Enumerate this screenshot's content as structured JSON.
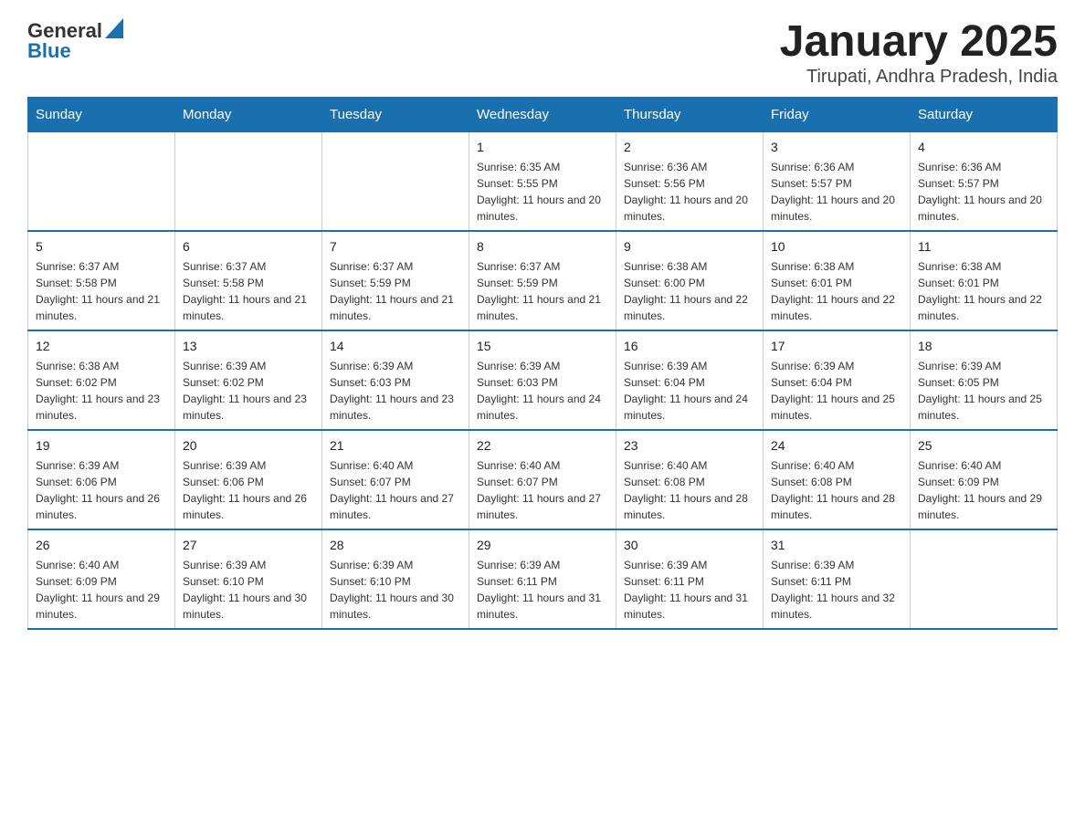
{
  "logo": {
    "text_general": "General",
    "text_blue": "Blue"
  },
  "header": {
    "title": "January 2025",
    "subtitle": "Tirupati, Andhra Pradesh, India"
  },
  "days_of_week": [
    "Sunday",
    "Monday",
    "Tuesday",
    "Wednesday",
    "Thursday",
    "Friday",
    "Saturday"
  ],
  "weeks": [
    [
      {
        "day": "",
        "info": ""
      },
      {
        "day": "",
        "info": ""
      },
      {
        "day": "",
        "info": ""
      },
      {
        "day": "1",
        "info": "Sunrise: 6:35 AM\nSunset: 5:55 PM\nDaylight: 11 hours and 20 minutes."
      },
      {
        "day": "2",
        "info": "Sunrise: 6:36 AM\nSunset: 5:56 PM\nDaylight: 11 hours and 20 minutes."
      },
      {
        "day": "3",
        "info": "Sunrise: 6:36 AM\nSunset: 5:57 PM\nDaylight: 11 hours and 20 minutes."
      },
      {
        "day": "4",
        "info": "Sunrise: 6:36 AM\nSunset: 5:57 PM\nDaylight: 11 hours and 20 minutes."
      }
    ],
    [
      {
        "day": "5",
        "info": "Sunrise: 6:37 AM\nSunset: 5:58 PM\nDaylight: 11 hours and 21 minutes."
      },
      {
        "day": "6",
        "info": "Sunrise: 6:37 AM\nSunset: 5:58 PM\nDaylight: 11 hours and 21 minutes."
      },
      {
        "day": "7",
        "info": "Sunrise: 6:37 AM\nSunset: 5:59 PM\nDaylight: 11 hours and 21 minutes."
      },
      {
        "day": "8",
        "info": "Sunrise: 6:37 AM\nSunset: 5:59 PM\nDaylight: 11 hours and 21 minutes."
      },
      {
        "day": "9",
        "info": "Sunrise: 6:38 AM\nSunset: 6:00 PM\nDaylight: 11 hours and 22 minutes."
      },
      {
        "day": "10",
        "info": "Sunrise: 6:38 AM\nSunset: 6:01 PM\nDaylight: 11 hours and 22 minutes."
      },
      {
        "day": "11",
        "info": "Sunrise: 6:38 AM\nSunset: 6:01 PM\nDaylight: 11 hours and 22 minutes."
      }
    ],
    [
      {
        "day": "12",
        "info": "Sunrise: 6:38 AM\nSunset: 6:02 PM\nDaylight: 11 hours and 23 minutes."
      },
      {
        "day": "13",
        "info": "Sunrise: 6:39 AM\nSunset: 6:02 PM\nDaylight: 11 hours and 23 minutes."
      },
      {
        "day": "14",
        "info": "Sunrise: 6:39 AM\nSunset: 6:03 PM\nDaylight: 11 hours and 23 minutes."
      },
      {
        "day": "15",
        "info": "Sunrise: 6:39 AM\nSunset: 6:03 PM\nDaylight: 11 hours and 24 minutes."
      },
      {
        "day": "16",
        "info": "Sunrise: 6:39 AM\nSunset: 6:04 PM\nDaylight: 11 hours and 24 minutes."
      },
      {
        "day": "17",
        "info": "Sunrise: 6:39 AM\nSunset: 6:04 PM\nDaylight: 11 hours and 25 minutes."
      },
      {
        "day": "18",
        "info": "Sunrise: 6:39 AM\nSunset: 6:05 PM\nDaylight: 11 hours and 25 minutes."
      }
    ],
    [
      {
        "day": "19",
        "info": "Sunrise: 6:39 AM\nSunset: 6:06 PM\nDaylight: 11 hours and 26 minutes."
      },
      {
        "day": "20",
        "info": "Sunrise: 6:39 AM\nSunset: 6:06 PM\nDaylight: 11 hours and 26 minutes."
      },
      {
        "day": "21",
        "info": "Sunrise: 6:40 AM\nSunset: 6:07 PM\nDaylight: 11 hours and 27 minutes."
      },
      {
        "day": "22",
        "info": "Sunrise: 6:40 AM\nSunset: 6:07 PM\nDaylight: 11 hours and 27 minutes."
      },
      {
        "day": "23",
        "info": "Sunrise: 6:40 AM\nSunset: 6:08 PM\nDaylight: 11 hours and 28 minutes."
      },
      {
        "day": "24",
        "info": "Sunrise: 6:40 AM\nSunset: 6:08 PM\nDaylight: 11 hours and 28 minutes."
      },
      {
        "day": "25",
        "info": "Sunrise: 6:40 AM\nSunset: 6:09 PM\nDaylight: 11 hours and 29 minutes."
      }
    ],
    [
      {
        "day": "26",
        "info": "Sunrise: 6:40 AM\nSunset: 6:09 PM\nDaylight: 11 hours and 29 minutes."
      },
      {
        "day": "27",
        "info": "Sunrise: 6:39 AM\nSunset: 6:10 PM\nDaylight: 11 hours and 30 minutes."
      },
      {
        "day": "28",
        "info": "Sunrise: 6:39 AM\nSunset: 6:10 PM\nDaylight: 11 hours and 30 minutes."
      },
      {
        "day": "29",
        "info": "Sunrise: 6:39 AM\nSunset: 6:11 PM\nDaylight: 11 hours and 31 minutes."
      },
      {
        "day": "30",
        "info": "Sunrise: 6:39 AM\nSunset: 6:11 PM\nDaylight: 11 hours and 31 minutes."
      },
      {
        "day": "31",
        "info": "Sunrise: 6:39 AM\nSunset: 6:11 PM\nDaylight: 11 hours and 32 minutes."
      },
      {
        "day": "",
        "info": ""
      }
    ]
  ]
}
